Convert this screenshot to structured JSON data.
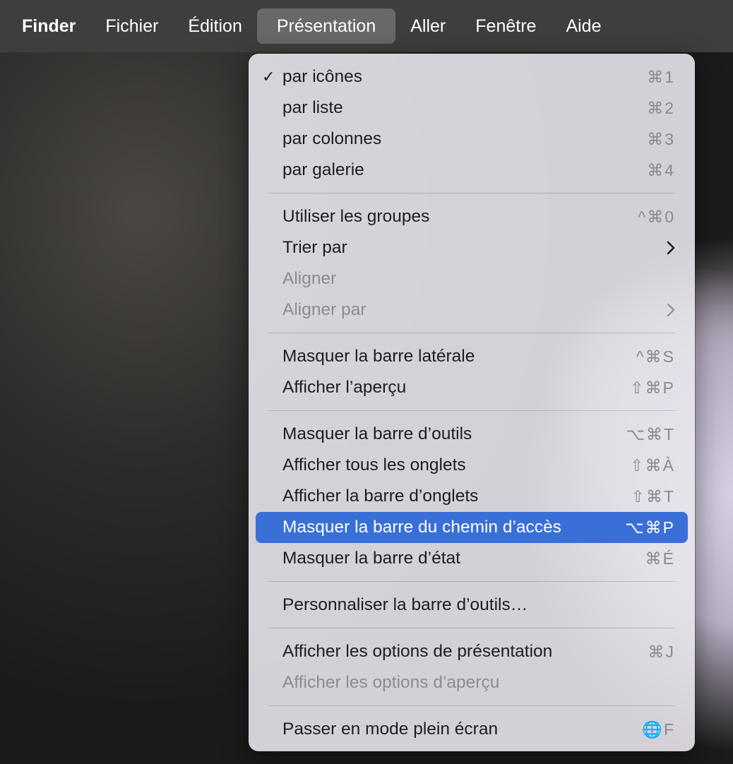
{
  "menubar": {
    "app": "Finder",
    "items": [
      "Fichier",
      "Édition",
      "Présentation",
      "Aller",
      "Fenêtre",
      "Aide"
    ]
  },
  "menu": {
    "group1": [
      {
        "label": "par icônes",
        "shortcut": "⌘1",
        "checked": true
      },
      {
        "label": "par liste",
        "shortcut": "⌘2"
      },
      {
        "label": "par colonnes",
        "shortcut": "⌘3"
      },
      {
        "label": "par galerie",
        "shortcut": "⌘4"
      }
    ],
    "group2": [
      {
        "label": "Utiliser les groupes",
        "shortcut": "^⌘0"
      },
      {
        "label": "Trier par",
        "submenu": true
      },
      {
        "label": "Aligner",
        "disabled": true
      },
      {
        "label": "Aligner par",
        "submenu": true,
        "disabled": true
      }
    ],
    "group3": [
      {
        "label": "Masquer la barre latérale",
        "shortcut": "^⌘S"
      },
      {
        "label": "Afficher l’aperçu",
        "shortcut": "⇧⌘P"
      }
    ],
    "group4": [
      {
        "label": "Masquer la barre d’outils",
        "shortcut": "⌥⌘T"
      },
      {
        "label": "Afficher tous les onglets",
        "shortcut": "⇧⌘À"
      },
      {
        "label": "Afficher la barre d’onglets",
        "shortcut": "⇧⌘T"
      },
      {
        "label": "Masquer la barre du chemin d’accès",
        "shortcut": "⌥⌘P",
        "selected": true
      },
      {
        "label": "Masquer la barre d’état",
        "shortcut": "⌘É"
      }
    ],
    "group5": [
      {
        "label": "Personnaliser la barre d’outils…"
      }
    ],
    "group6": [
      {
        "label": "Afficher les options de présentation",
        "shortcut": "⌘J"
      },
      {
        "label": "Afficher les options d’aperçu",
        "disabled": true
      }
    ],
    "group7": [
      {
        "label": "Passer en mode plein écran",
        "shortcut": "🌐F"
      }
    ],
    "check_mark": "✓"
  },
  "colors": {
    "menubar_bg": "#3f3e3c",
    "highlight": "#3a6fd8",
    "disabled_text": "#8d8b90"
  }
}
